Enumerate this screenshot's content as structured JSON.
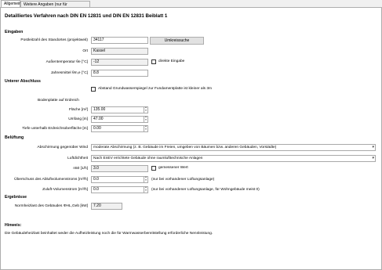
{
  "tabs": [
    "Allgemein",
    "Weitere Angaben (nur für Druckausgabe)"
  ],
  "title": "Detailliertes Verfahren nach DIN EN 12831 und DIN EN 12831 Beiblatt 1",
  "eingaben": {
    "header": "Eingaben",
    "plz_label": "Postleitzahl des Standortes (projektweit)",
    "plz_value": "34117",
    "umkreis_button": "Umkreissuche",
    "ort_label": "Ort",
    "ort_value": "Kassel",
    "aussentemp_label": "Außentemperatur θe [°C]",
    "aussentemp_value": "-12",
    "direkte_eingabe": "direkte Eingabe",
    "jahresmittel_label": "Jahresmittel θm,e [°C]",
    "jahresmittel_value": "8.8"
  },
  "unterer": {
    "header": "Unterer Abschluss",
    "grundwasser_label": "Abstand Grundwasserspiegel zur Fundamentplatte ist kleiner als 3m",
    "bodenplatte_label": "Bodenplatte auf Erdreich",
    "flaeche_label": "Fläche [m²]",
    "flaeche_value": "135.00",
    "umfang_label": "Umfang [m]",
    "umfang_value": "47.00",
    "tiefe_label": "Tiefe unterhalb Erdreichsoberfläche [m]",
    "tiefe_value": "0.00"
  },
  "lueftung": {
    "header": "Belüftung",
    "abschirmung_label": "Abschirmung gegenüber Wind",
    "abschirmung_value": "moderate Abschirmung (z. B. Gebäude im Freien, umgeben von Bäumen bzw. anderen Gebäuden, Vorstädte)",
    "luftdicht_label": "Luftdichtheit",
    "luftdicht_value": "Nach EnEV errichtete Gebäude ohne raumlufttechnische Anlagen",
    "n50_label": "n50 [1/h]",
    "n50_value": "3.0",
    "gemessen_label": "gemessener Wert",
    "ueberschuss_label": "Überschuss des Abluftvolumenstroms [m³/h]",
    "ueberschuss_value": "0.0",
    "ueberschuss_hint": "(nur bei vorhandener Lüftungsanlage)",
    "zuluft_label": "Zuluft-Volumenstrom [m³/h]",
    "zuluft_value": "0.0",
    "zuluft_hint": "(nur bei vorhandener Lüftungsanlage, für Wohngebäude meist 0)"
  },
  "ergebnisse": {
    "header": "Ergebnisse",
    "norm_label": "Normheizlast des Gebäudes ΦHL,Geb [kW]",
    "norm_value": "7.20"
  },
  "hinweis": {
    "header": "Hinweis:",
    "text": "Die Gebäudeheizlast beinhaltet weder die Aufheizleistung noch die für Warmwasserbereitstellung erforderliche Nennleistung."
  }
}
